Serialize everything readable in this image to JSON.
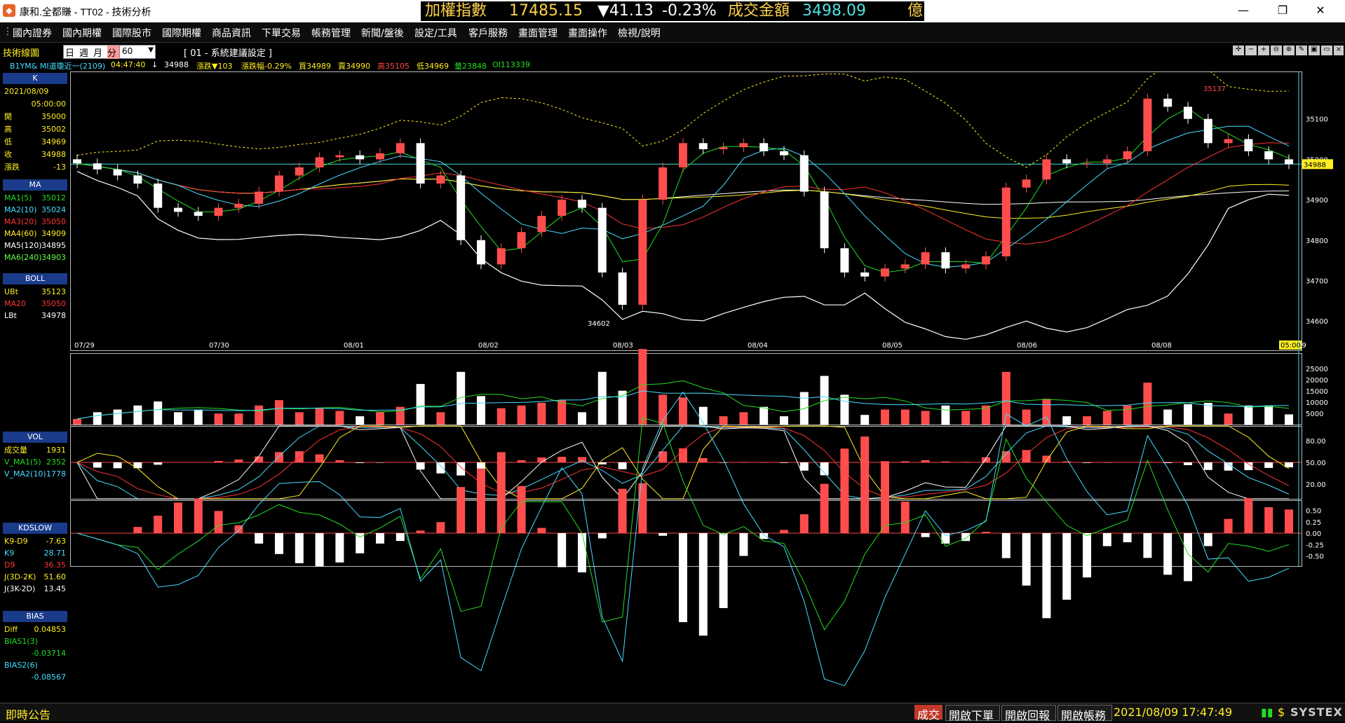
{
  "window": {
    "app_icon": "systex-app-icon",
    "title": "康和.全都賺 - TT02 - 技術分析",
    "controls": {
      "minimize": "—",
      "maximize": "❐",
      "close": "✕"
    }
  },
  "ticker": {
    "name": "加權指數",
    "value": "17485.15",
    "change": "▼41.13",
    "percent": "-0.23%",
    "volume_label": "成交金額",
    "volume": "3498.09",
    "unit": "億"
  },
  "menu": [
    "國內證券",
    "國內期權",
    "國際股市",
    "國際期權",
    "商品資訊",
    "下單交易",
    "帳務管理",
    "新聞/盤後",
    "設定/工具",
    "客戶服務",
    "畫面管理",
    "畫面操作",
    "檢視/說明"
  ],
  "toolbar": {
    "title": "技術線圖",
    "periods": [
      "日",
      "週",
      "月",
      "分"
    ],
    "active_period": "分",
    "interval": "60",
    "setting": "[ 01 - 系統建議設定 ]"
  },
  "quote_line": {
    "symbol": "B1YM&  MI道瓊近一(2109)",
    "time": "04:47:40",
    "arrow": "↓",
    "price": "34988",
    "change": "漲跌▼103",
    "pct": "漲跌幅-0.29%",
    "bid": "買34989",
    "ask": "賣34990",
    "high": "高35105",
    "low": "低34969",
    "vol": "量23848",
    "oi": "OI113339"
  },
  "sidebar": {
    "k_head": "K",
    "date": "2021/08/09",
    "time": "05:00:00",
    "ohlc": [
      {
        "label": "開",
        "value": "35000"
      },
      {
        "label": "高",
        "value": "35002"
      },
      {
        "label": "低",
        "value": "34969"
      },
      {
        "label": "收",
        "value": "34988"
      },
      {
        "label": "漲跌",
        "value": "-13"
      }
    ],
    "ma_head": "MA",
    "ma": [
      {
        "label": "MA1(5)",
        "value": "35012",
        "color": "#22dd22"
      },
      {
        "label": "MA2(10)",
        "value": "35024",
        "color": "#44ddff"
      },
      {
        "label": "MA3(20)",
        "value": "35050",
        "color": "#ff3333"
      },
      {
        "label": "MA4(60)",
        "value": "34909",
        "color": "#ffee22"
      },
      {
        "label": "MA5(120)",
        "value": "34895",
        "color": "#ffffff"
      },
      {
        "label": "MA6(240)",
        "value": "34903",
        "color": "#66ff44"
      }
    ],
    "boll_head": "BOLL",
    "boll": [
      {
        "label": "UBt",
        "value": "35123",
        "color": "#ffee22"
      },
      {
        "label": "MA20",
        "value": "35050",
        "color": "#ff3333"
      },
      {
        "label": "LBt",
        "value": "34978",
        "color": "#ffffff"
      }
    ],
    "vol_head": "VOL",
    "vol": [
      {
        "label": "成交量",
        "value": "1931",
        "color": "#ffee22"
      },
      {
        "label": "V_MA1(5)",
        "value": "2352",
        "color": "#22dd22"
      },
      {
        "label": "V_MA2(10)",
        "value": "1778",
        "color": "#44ddff"
      }
    ],
    "kd_head": "KDSLOW",
    "kd": [
      {
        "label": "K9-D9",
        "value": "-7.63",
        "color": "#ffee22"
      },
      {
        "label": "K9",
        "value": "28.71",
        "color": "#44ddff"
      },
      {
        "label": "D9",
        "value": "36.35",
        "color": "#ff3333"
      },
      {
        "label": "J(3D-2K)",
        "value": "51.60",
        "color": "#ffee22"
      },
      {
        "label": "J(3K-2D)",
        "value": "13.45",
        "color": "#ffffff"
      }
    ],
    "bias_head": "BIAS",
    "bias": [
      {
        "label": "Diff",
        "value": "0.04853",
        "color": "#ffee22"
      },
      {
        "label": "BIAS1(3)",
        "value": "",
        "color": "#22dd22"
      },
      {
        "label": "",
        "value": "-0.03714",
        "color": "#22dd22"
      },
      {
        "label": "BIAS2(6)",
        "value": "",
        "color": "#44ddff"
      },
      {
        "label": "",
        "value": "-0.08567",
        "color": "#44ddff"
      }
    ]
  },
  "chart_data": {
    "type": "candlestick",
    "price_axis": [
      "35100",
      "35000",
      "34900",
      "34800",
      "34700",
      "34600"
    ],
    "date_labels": [
      "07/29",
      "07/30",
      "08/01",
      "08/02",
      "08/03",
      "08/04",
      "08/05",
      "08/06",
      "08/08",
      "08/09"
    ],
    "last_time_label": "05:00",
    "last_price_label": "34988",
    "high_label": "35137",
    "low_label": "34602",
    "closes": [
      34990,
      34975,
      34960,
      34940,
      34880,
      34870,
      34860,
      34880,
      34890,
      34920,
      34960,
      34980,
      35005,
      35010,
      35000,
      35015,
      35040,
      34940,
      34960,
      34800,
      34740,
      34780,
      34820,
      34860,
      34900,
      34880,
      34720,
      34640,
      34900,
      34980,
      35040,
      35025,
      35030,
      35040,
      35020,
      35010,
      34920,
      34780,
      34720,
      34710,
      34730,
      34740,
      34770,
      34730,
      34740,
      34760,
      34930,
      34950,
      35000,
      34990,
      34990,
      35000,
      35020,
      35150,
      35130,
      35100,
      35040,
      35050,
      35020,
      35000,
      34988
    ],
    "vol_axis": [
      "25000",
      "20000",
      "15000",
      "10000",
      "5000"
    ],
    "kd_axis": [
      "80.00",
      "50.00",
      "20.00"
    ],
    "bias_axis": [
      "0.50",
      "0.25",
      "0.00",
      "-0.25",
      "-0.50"
    ]
  },
  "status": {
    "notice": "即時公告",
    "deal": "成交",
    "open_order": "開啟下單",
    "open_report": "開啟回報",
    "open_account": "開啟帳務",
    "datetime": "2021/08/09 17:47:49",
    "brand": "SYSTEX"
  }
}
